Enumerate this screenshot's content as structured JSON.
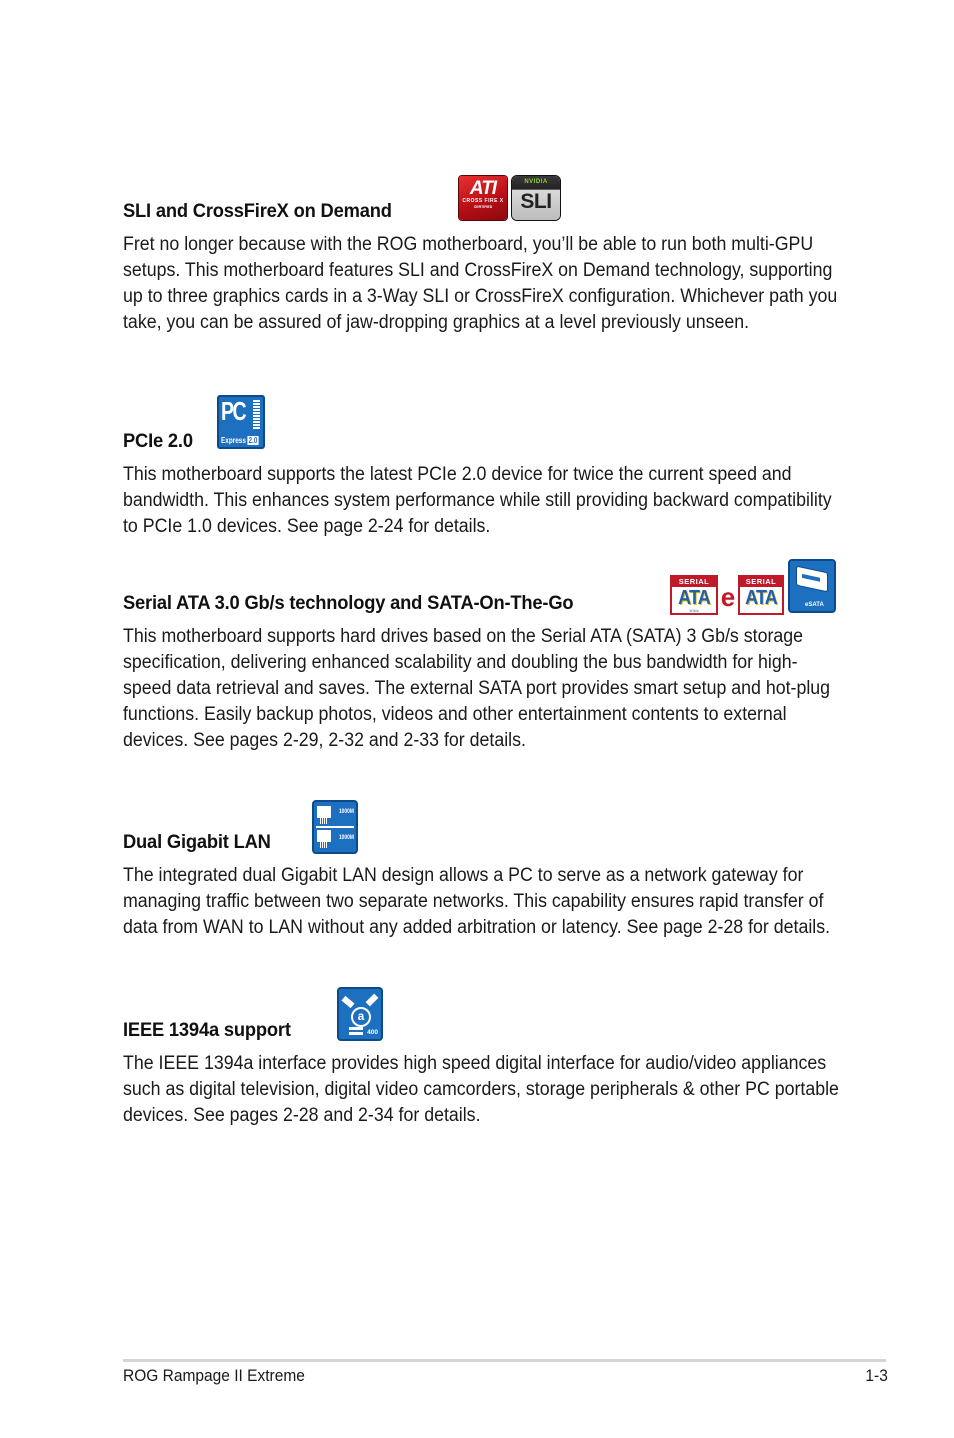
{
  "sections": [
    {
      "heading": "SLI and CrossFireX on Demand",
      "logos": [
        {
          "icon": "ati-crossfirex-certified-logo",
          "text": "ATI",
          "sub": "CROSS FIRE X",
          "cert": "CERTIFIED"
        },
        {
          "icon": "nvidia-sli-logo",
          "brand": "NVIDIA",
          "text": "SLI"
        }
      ],
      "body": "Fret no longer because with the ROG motherboard, you’ll be able to run both multi-GPU setups. This motherboard features SLI and CrossFireX on Demand technology, supporting up to three graphics cards in a 3-Way SLI or CrossFireX configuration. Whichever path you take, you can be assured of jaw-dropping graphics at a level previously unseen."
    },
    {
      "heading": "PCIe 2.0",
      "logos": [
        {
          "icon": "pci-express-2-logo",
          "text": "PC",
          "sub": "Express",
          "version": "2.0"
        }
      ],
      "body": "This motherboard supports the latest PCIe 2.0 device for twice the current speed and bandwidth. This enhances system performance while still providing backward compatibility to PCIe 1.0 devices. See page 2-24 for details."
    },
    {
      "heading": "Serial ATA 3.0 Gb/s technology and SATA-On-The-Go",
      "logos": [
        {
          "icon": "serial-ata-logo",
          "top": "SERIAL",
          "text": "ATA",
          "sub": "3Gb/s"
        },
        {
          "icon": "esata-e-logo",
          "text": "e"
        },
        {
          "icon": "serial-ata-logo",
          "top": "SERIAL",
          "text": "ATA"
        },
        {
          "icon": "esata-port-logo",
          "text": "eSATA"
        }
      ],
      "body": "This motherboard supports hard drives based on the Serial ATA (SATA) 3 Gb/s storage specification, delivering enhanced scalability and doubling the bus bandwidth for high-speed data retrieval and saves. The external SATA port provides smart setup and hot-plug functions. Easily backup photos, videos and other entertainment contents to external devices. See pages 2-29, 2-32 and 2-33 for details."
    },
    {
      "heading": "Dual Gigabit LAN",
      "logos": [
        {
          "icon": "dual-lan-logo",
          "speed_top": "1000M",
          "speed_bottom": "1000M"
        }
      ],
      "body": "The integrated dual Gigabit LAN design allows a PC to serve as a network gateway for managing traffic between two separate networks. This capability ensures rapid transfer of data from WAN to LAN without any added arbitration or latency. See page 2-28 for details."
    },
    {
      "heading": "IEEE 1394a support",
      "logos": [
        {
          "icon": "ieee1394a-logo",
          "text": "a",
          "speed": "400"
        }
      ],
      "body": "The IEEE 1394a interface provides high speed digital interface for audio/video appliances such as digital television, digital video camcorders, storage peripherals & other PC portable devices. See pages 2-28 and 2-34 for details."
    }
  ],
  "footer": {
    "title": "ROG Rampage II Extreme",
    "page": "1-3"
  },
  "colors": {
    "logo_blue": "#1d6fc0",
    "ati_red": "#c01a2a",
    "nvidia_green": "#8fd13a",
    "footer_rule": "#d4d4d4"
  }
}
